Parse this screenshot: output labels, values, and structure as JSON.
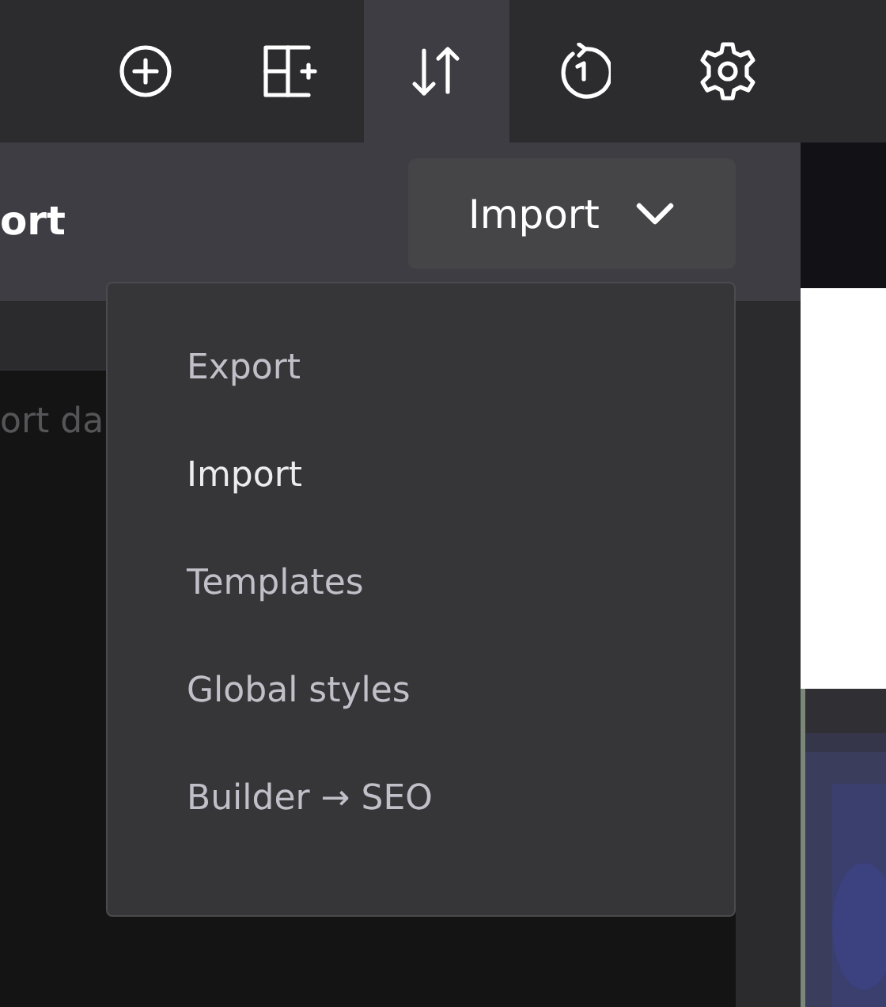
{
  "toolbar": {
    "buttons": [
      {
        "kind": "add",
        "selected": false
      },
      {
        "kind": "layout",
        "selected": false
      },
      {
        "kind": "sort",
        "selected": true
      },
      {
        "kind": "history",
        "selected": false
      },
      {
        "kind": "settings",
        "selected": false
      }
    ]
  },
  "panel": {
    "title": "ort",
    "dropdown": {
      "label": "Import",
      "expanded": true
    },
    "textarea": {
      "placeholder": "ort da"
    }
  },
  "menu": {
    "items": [
      {
        "label": "Export",
        "selected": false
      },
      {
        "label": "Import",
        "selected": true
      },
      {
        "label": "Templates",
        "selected": false
      },
      {
        "label": "Global styles",
        "selected": false
      },
      {
        "label": "Builder → SEO",
        "selected": false
      }
    ]
  }
}
